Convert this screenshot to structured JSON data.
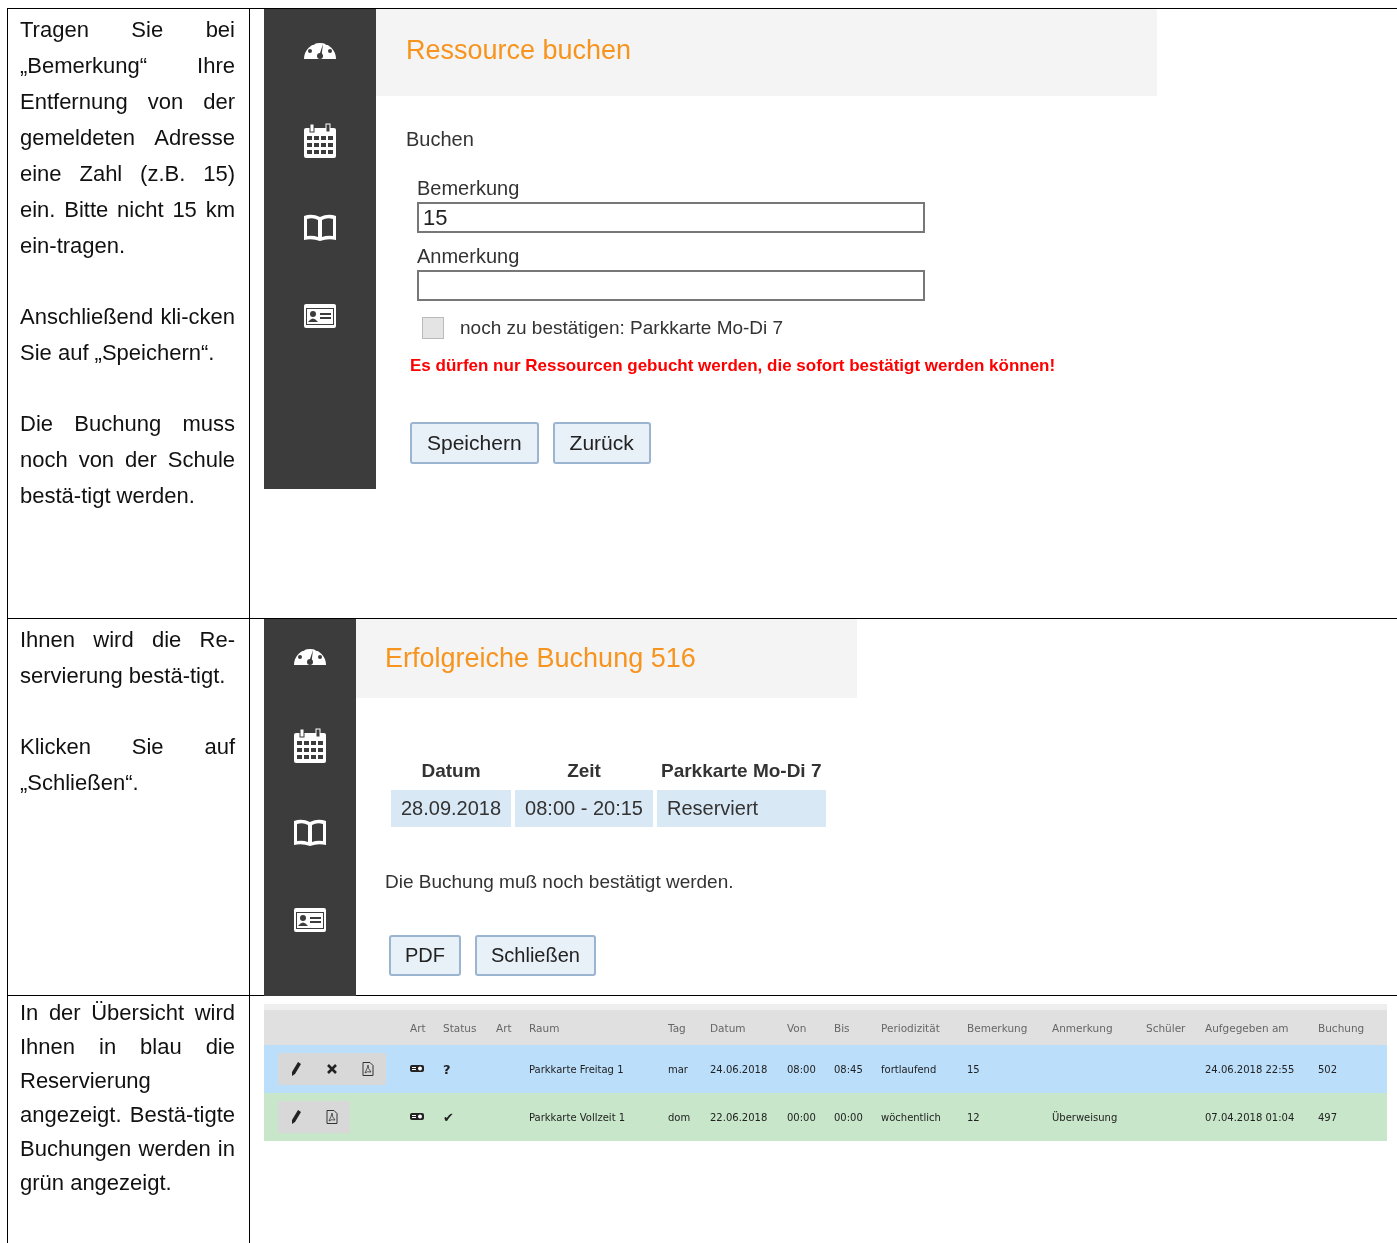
{
  "instructions": [
    {
      "paragraphs": [
        "Tragen Sie bei „Bemerkung“ Ihre Entfernung von der gemeldeten Adresse eine Zahl (z.B. 15) ein. Bitte nicht 15 km ein-tragen.",
        "Anschließend kli-cken Sie auf „Speichern“.",
        "Die Buchung muss noch von der Schule bestä-tigt werden."
      ]
    },
    {
      "paragraphs": [
        "Ihnen wird die Re-servierung bestä-tigt.",
        "Klicken Sie auf „Schließen“."
      ]
    },
    {
      "paragraphs": [
        "In der Übersicht wird Ihnen in blau die Reservierung angezeigt. Bestä-tigte Buchungen werden in grün angezeigt."
      ]
    }
  ],
  "booking_form": {
    "title": "Ressource buchen",
    "section": "Buchen",
    "fields": [
      {
        "label": "Bemerkung",
        "value": "15"
      },
      {
        "label": "Anmerkung"
      }
    ],
    "checkbox": {
      "label": "noch zu bestätigen: Parkkarte Mo-Di 7",
      "checked": false
    },
    "warning": "Es dürfen nur Ressourcen gebucht werden, die sofort bestätigt werden können!",
    "buttons": [
      "Speichern",
      "Zurück"
    ]
  },
  "booking_success": {
    "title": "Erfolgreiche Buchung 516",
    "table": {
      "columns": [
        "Datum",
        "Zeit",
        "Parkkarte Mo-Di 7"
      ],
      "rows": [
        [
          "28.09.2018",
          "08:00 - 20:15",
          "Reserviert"
        ]
      ]
    },
    "message": "Die Buchung muß noch bestätigt werden.",
    "buttons": [
      "PDF",
      "Schließen"
    ]
  },
  "bookings_table": {
    "columns": [
      "Art",
      "Status",
      "Art",
      "Raum",
      "Tag",
      "Datum",
      "Von",
      "Bis",
      "Periodizität",
      "Bemerkung",
      "Anmerkung",
      "Schüler",
      "Aufgegeben am",
      "Buchung"
    ],
    "rows": [
      {
        "kind": "pending",
        "cells": [
          null,
          "?",
          null,
          "Parkkarte Freitag 1",
          "mar",
          "24.06.2018",
          "08:00",
          "08:45",
          "fortlaufend",
          "15",
          null,
          null,
          "24.06.2018 22:55",
          "502"
        ]
      },
      {
        "kind": "confirmed",
        "cells": [
          null,
          "✔",
          null,
          "Parkkarte Vollzeit 1",
          "dom",
          "22.06.2018",
          "00:00",
          "00:00",
          "wöchentlich",
          "12",
          "Überweisung",
          null,
          "07.04.2018 01:04",
          "497"
        ]
      }
    ]
  }
}
